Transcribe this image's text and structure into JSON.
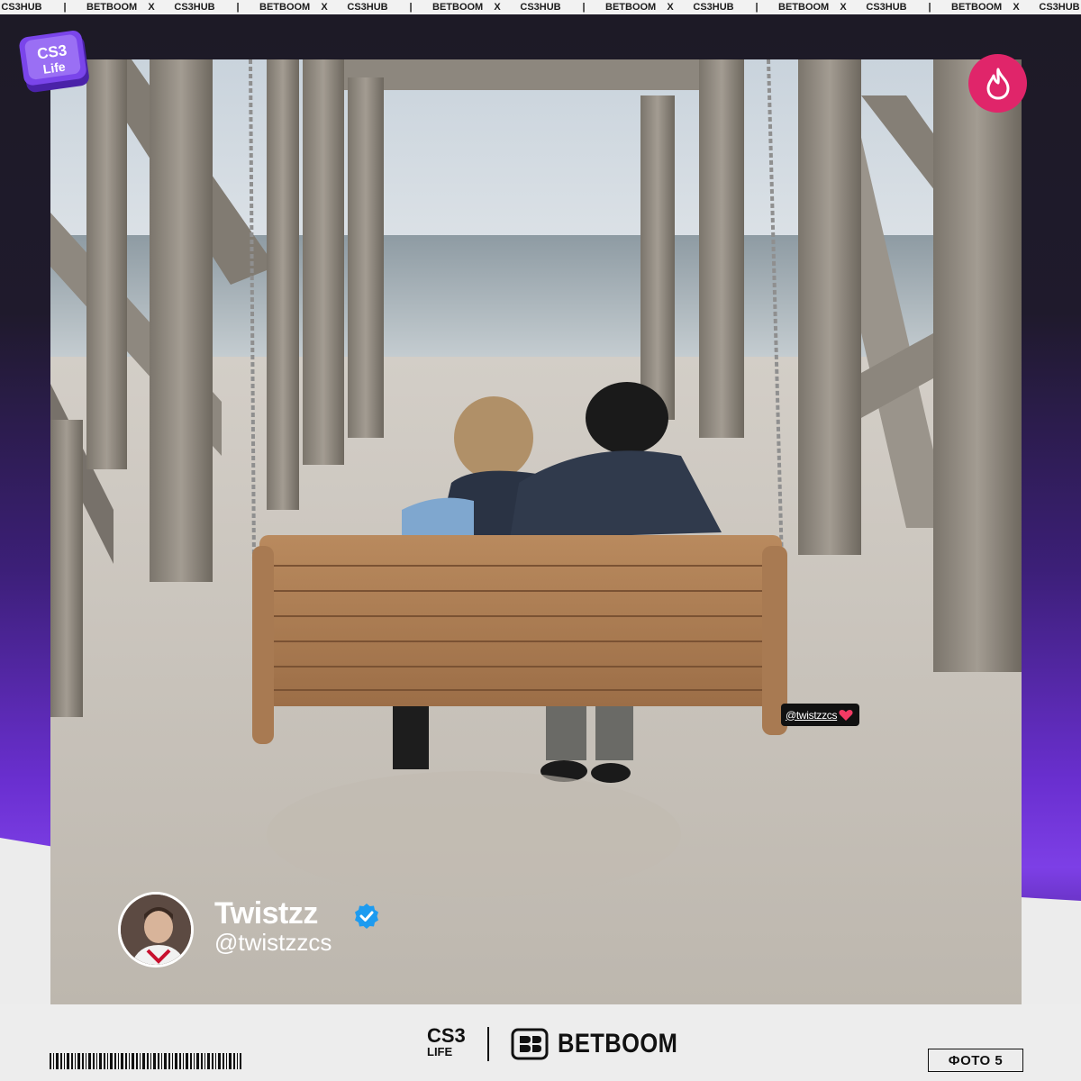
{
  "ticker": {
    "items": [
      "CS3HUB",
      "|",
      "BETBOOM",
      "X",
      "CS3HUB",
      "|",
      "BETBOOM",
      "X",
      "CS3HUB",
      "|",
      "BETBOOM",
      "X",
      "CS3HUB",
      "|",
      "BETBOOM",
      "X",
      "CS3HUB",
      "|",
      "BETBOOM",
      "X",
      "CS3HUB",
      "|",
      "BETBOOM",
      "X",
      "CS3HUB"
    ]
  },
  "logo": {
    "line1": "CS3",
    "line2": "Life"
  },
  "photo": {
    "tag": "@twistzzcs"
  },
  "profile": {
    "name": "Twistzz",
    "handle": "@twistzzcs",
    "verified_icon": "verified-badge-icon"
  },
  "footer": {
    "cs3_line1": "CS3",
    "cs3_line2": "LIFE",
    "brand": "BETBOOM",
    "photo_label": "ФОТО 5"
  },
  "colors": {
    "accent_purple": "#7d3fe6",
    "fire_badge": "#e0256a",
    "verified_blue": "#1d9bf0"
  }
}
